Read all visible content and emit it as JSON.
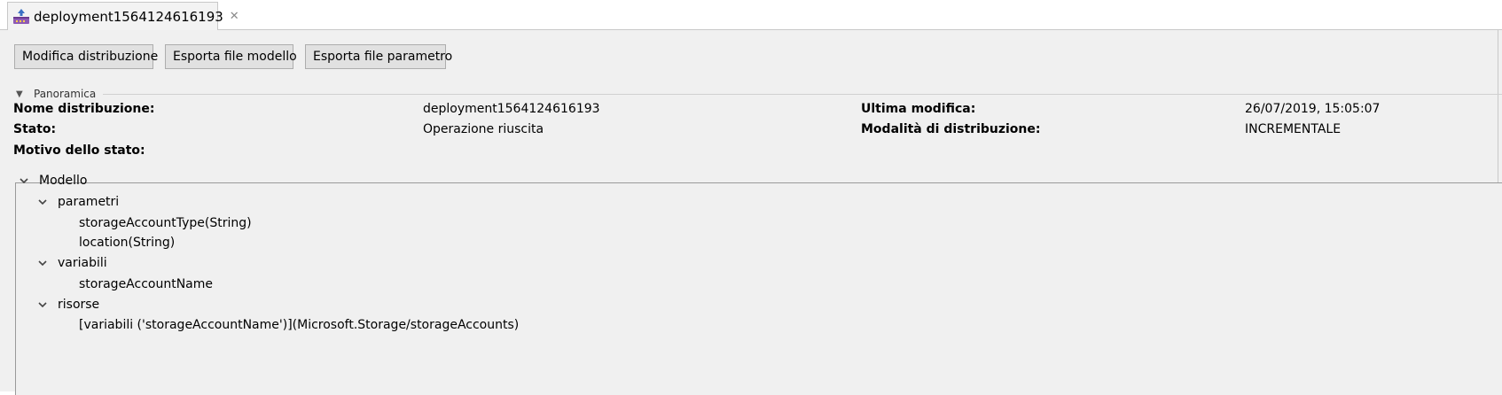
{
  "tab": {
    "title": "deployment1564124616193",
    "close_glyph": "✕",
    "icon": "deployment-icon"
  },
  "toolbar": {
    "edit_label": "Modifica distribuzione",
    "export_template_label": "Esporta file modello",
    "export_params_label": "Esporta file parametro"
  },
  "overview": {
    "title": "Panoramica",
    "name_label": "Nome distribuzione:",
    "name_value": "deployment1564124616193",
    "state_label": "Stato:",
    "state_value": "Operazione riuscita",
    "reason_label": "Motivo dello stato:",
    "modified_label": "Ultima modifica:",
    "modified_value": "26/07/2019, 15:05:07",
    "mode_label": "Modalità di distribuzione:",
    "mode_value": "INCREMENTALE"
  },
  "tree": {
    "root": "Modello",
    "groups": [
      {
        "label": "parametri",
        "items": [
          "storageAccountType(String)",
          "location(String)"
        ]
      },
      {
        "label": "variabili",
        "items": [
          "storageAccountName"
        ]
      },
      {
        "label": "risorse",
        "items": [
          "[variabili ('storageAccountName')](Microsoft.Storage/storageAccounts)"
        ]
      }
    ]
  },
  "colors": {
    "background": "#f0f0f0",
    "button_bg": "#e1e1e1",
    "icon_purple": "#7b3fa0"
  }
}
